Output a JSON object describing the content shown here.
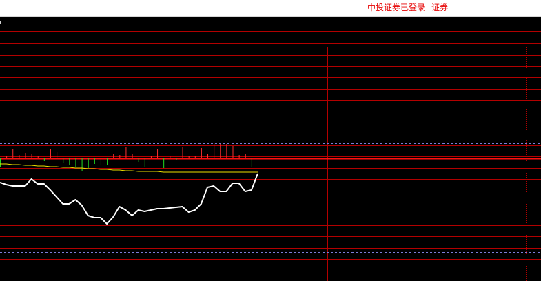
{
  "status_bar": {
    "login_status": "中投证券已登录",
    "broker_name": "证券"
  },
  "colors": {
    "background": "#000000",
    "status_text": "#e60000",
    "grid_line": "#b30000",
    "grid_dotted": "#b30000",
    "price_line": "#ff1010",
    "dashed_level": "#7c7cd8",
    "histogram_up": "#ff3030",
    "histogram_down": "#22dd22",
    "signal_line": "#f0e000",
    "main_line": "#ffffff"
  },
  "chart_data": {
    "type": "line",
    "series": [
      {
        "values": [
          265,
          268,
          270,
          270,
          270,
          260,
          267,
          267,
          276,
          286,
          296,
          296,
          290,
          298,
          313,
          316,
          316,
          325,
          315,
          300,
          305,
          313,
          305,
          307,
          305,
          303,
          303,
          302,
          301,
          300,
          308,
          305,
          296,
          272,
          270,
          278,
          278,
          266,
          266,
          278,
          276,
          252
        ]
      },
      {
        "values": [
          238,
          238,
          239,
          239,
          240,
          240,
          241,
          241,
          242,
          242,
          243,
          243,
          244,
          244,
          245,
          245,
          246,
          246,
          247,
          247,
          248,
          248,
          249,
          249,
          249,
          249,
          250,
          250,
          250,
          250,
          250,
          250,
          250,
          250,
          250,
          250,
          250,
          250,
          250,
          250,
          250,
          250
        ]
      },
      {
        "values": [
          -13,
          2,
          12,
          4,
          7,
          5,
          2,
          -5,
          12,
          9,
          -8,
          -10,
          -14,
          -20,
          -15,
          -9,
          -10,
          -10,
          5,
          4,
          16,
          5,
          -6,
          -14,
          2,
          13,
          -15,
          2,
          -4,
          15,
          3,
          2,
          14,
          6,
          22,
          20,
          20,
          17,
          4,
          6,
          -13,
          12
        ]
      }
    ]
  }
}
